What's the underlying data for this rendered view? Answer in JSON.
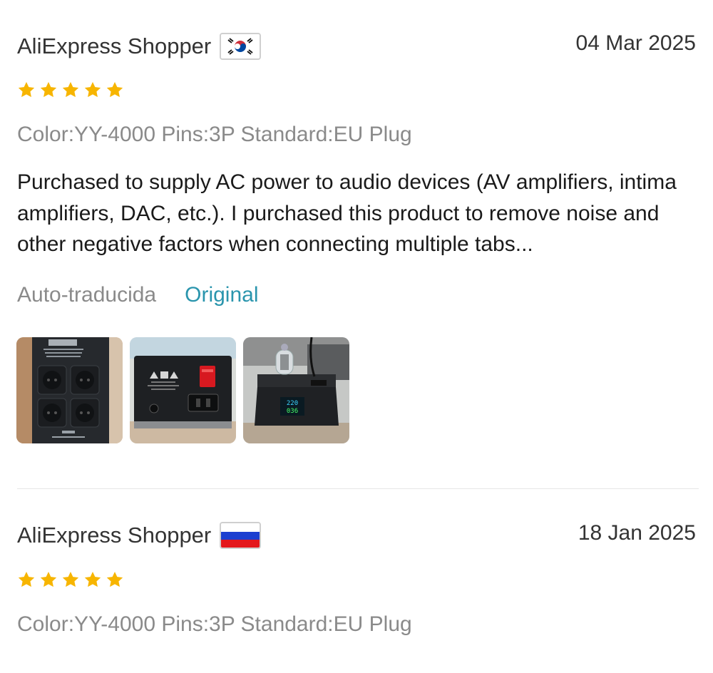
{
  "reviews": [
    {
      "reviewer": "AliExpress Shopper",
      "country_flag": "south-korea-flag-icon",
      "date": "04 Mar 2025",
      "rating": 5,
      "rating_max": 5,
      "sku": "Color:YY-4000 Pins:3P Standard:EU Plug",
      "text": "Purchased to supply AC power to audio devices (AV amplifiers, intima amplifiers, DAC, etc.). I purchased this product to remove noise and other negative factors when connecting multiple tabs...",
      "auto_translated_label": "Auto-traducida",
      "original_link": "Original",
      "photos": [
        "power-strip-front-photo",
        "power-strip-back-panel-photo",
        "power-conditioner-with-display-photo"
      ]
    },
    {
      "reviewer": "AliExpress Shopper",
      "country_flag": "russia-flag-icon",
      "date": "18 Jan 2025",
      "rating": 5,
      "rating_max": 5,
      "sku": "Color:YY-4000 Pins:3P Standard:EU Plug"
    }
  ],
  "photo_texts": {
    "meter_top": "220",
    "meter_bottom": "036"
  },
  "colors": {
    "star": "#f7b500",
    "link": "#2a95ad",
    "muted_text": "#8a8a8a",
    "divider": "#e6e6e6"
  }
}
